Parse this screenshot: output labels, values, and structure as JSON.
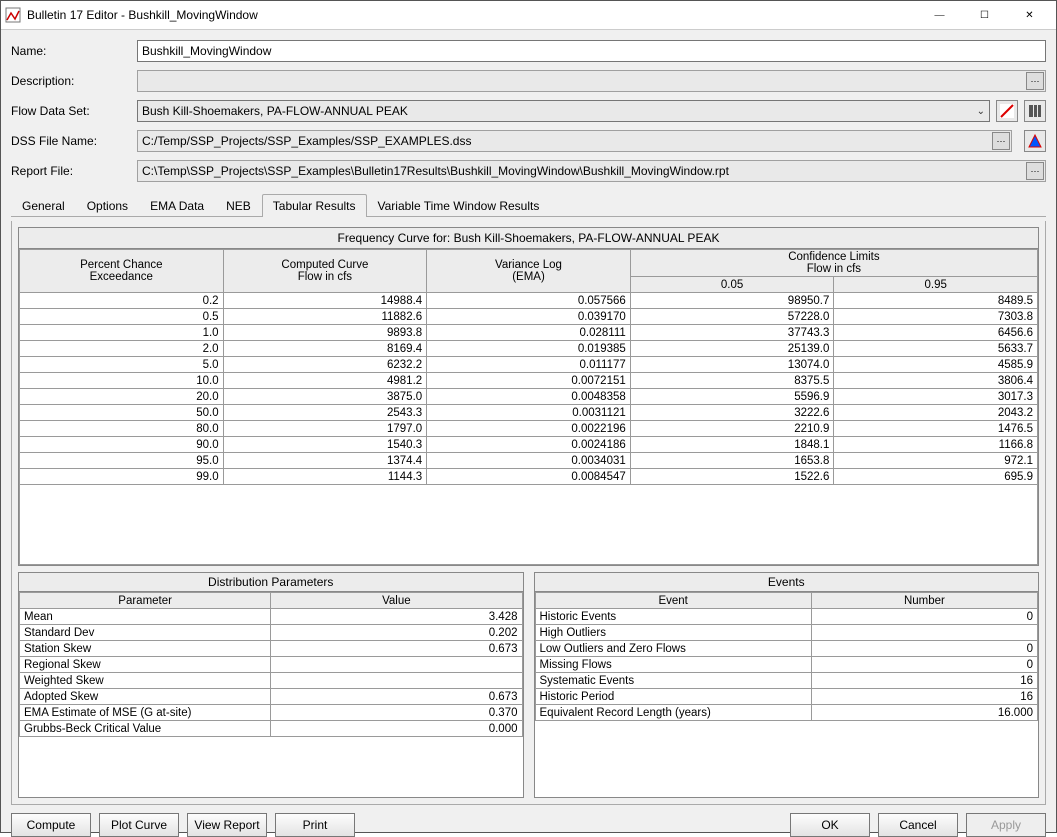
{
  "window": {
    "title": "Bulletin 17 Editor - Bushkill_MovingWindow"
  },
  "labels": {
    "name": "Name:",
    "description": "Description:",
    "flowDataSet": "Flow Data Set:",
    "dssFileName": "DSS File Name:",
    "reportFile": "Report File:"
  },
  "fields": {
    "name": "Bushkill_MovingWindow",
    "description": "",
    "flowDataSet": "Bush Kill-Shoemakers, PA-FLOW-ANNUAL PEAK",
    "dssFileName": "C:/Temp/SSP_Projects/SSP_Examples/SSP_EXAMPLES.dss",
    "reportFile": "C:\\Temp\\SSP_Projects\\SSP_Examples\\Bulletin17Results\\Bushkill_MovingWindow\\Bushkill_MovingWindow.rpt"
  },
  "tabs": {
    "general": "General",
    "options": "Options",
    "emaData": "EMA Data",
    "neb": "NEB",
    "tabularResults": "Tabular Results",
    "variableTimeWindow": "Variable Time Window Results"
  },
  "freq": {
    "title": "Frequency Curve for: Bush Kill-Shoemakers, PA-FLOW-ANNUAL PEAK",
    "headers": {
      "pct": "Percent Chance\nExceedance",
      "computed": "Computed Curve\nFlow in cfs",
      "variance": "Variance Log\n(EMA)",
      "conf": "Confidence Limits",
      "confSub": "Flow in cfs",
      "c05": "0.05",
      "c95": "0.95"
    },
    "rows": [
      {
        "pct": "0.2",
        "comp": "14988.4",
        "var": "0.057566",
        "c05": "98950.7",
        "c95": "8489.5"
      },
      {
        "pct": "0.5",
        "comp": "11882.6",
        "var": "0.039170",
        "c05": "57228.0",
        "c95": "7303.8"
      },
      {
        "pct": "1.0",
        "comp": "9893.8",
        "var": "0.028111",
        "c05": "37743.3",
        "c95": "6456.6"
      },
      {
        "pct": "2.0",
        "comp": "8169.4",
        "var": "0.019385",
        "c05": "25139.0",
        "c95": "5633.7"
      },
      {
        "pct": "5.0",
        "comp": "6232.2",
        "var": "0.011177",
        "c05": "13074.0",
        "c95": "4585.9"
      },
      {
        "pct": "10.0",
        "comp": "4981.2",
        "var": "0.0072151",
        "c05": "8375.5",
        "c95": "3806.4"
      },
      {
        "pct": "20.0",
        "comp": "3875.0",
        "var": "0.0048358",
        "c05": "5596.9",
        "c95": "3017.3"
      },
      {
        "pct": "50.0",
        "comp": "2543.3",
        "var": "0.0031121",
        "c05": "3222.6",
        "c95": "2043.2"
      },
      {
        "pct": "80.0",
        "comp": "1797.0",
        "var": "0.0022196",
        "c05": "2210.9",
        "c95": "1476.5"
      },
      {
        "pct": "90.0",
        "comp": "1540.3",
        "var": "0.0024186",
        "c05": "1848.1",
        "c95": "1166.8"
      },
      {
        "pct": "95.0",
        "comp": "1374.4",
        "var": "0.0034031",
        "c05": "1653.8",
        "c95": "972.1"
      },
      {
        "pct": "99.0",
        "comp": "1144.3",
        "var": "0.0084547",
        "c05": "1522.6",
        "c95": "695.9"
      }
    ]
  },
  "dist": {
    "title": "Distribution Parameters",
    "headers": {
      "param": "Parameter",
      "value": "Value"
    },
    "rows": [
      {
        "p": "Mean",
        "v": "3.428"
      },
      {
        "p": "Standard Dev",
        "v": "0.202"
      },
      {
        "p": "Station Skew",
        "v": "0.673"
      },
      {
        "p": "Regional Skew",
        "v": ""
      },
      {
        "p": "Weighted Skew",
        "v": ""
      },
      {
        "p": "Adopted Skew",
        "v": "0.673"
      },
      {
        "p": "EMA Estimate of MSE (G at-site)",
        "v": "0.370"
      },
      {
        "p": "Grubbs-Beck Critical Value",
        "v": "0.000"
      }
    ]
  },
  "events": {
    "title": "Events",
    "headers": {
      "event": "Event",
      "number": "Number"
    },
    "rows": [
      {
        "e": "Historic Events",
        "n": "0"
      },
      {
        "e": "High Outliers",
        "n": ""
      },
      {
        "e": "Low Outliers and Zero Flows",
        "n": "0"
      },
      {
        "e": "Missing Flows",
        "n": "0"
      },
      {
        "e": "Systematic Events",
        "n": "16"
      },
      {
        "e": "Historic Period",
        "n": "16"
      },
      {
        "e": "Equivalent Record Length (years)",
        "n": "16.000"
      }
    ]
  },
  "buttons": {
    "compute": "Compute",
    "plotCurve": "Plot Curve",
    "viewReport": "View Report",
    "print": "Print",
    "ok": "OK",
    "cancel": "Cancel",
    "apply": "Apply"
  }
}
